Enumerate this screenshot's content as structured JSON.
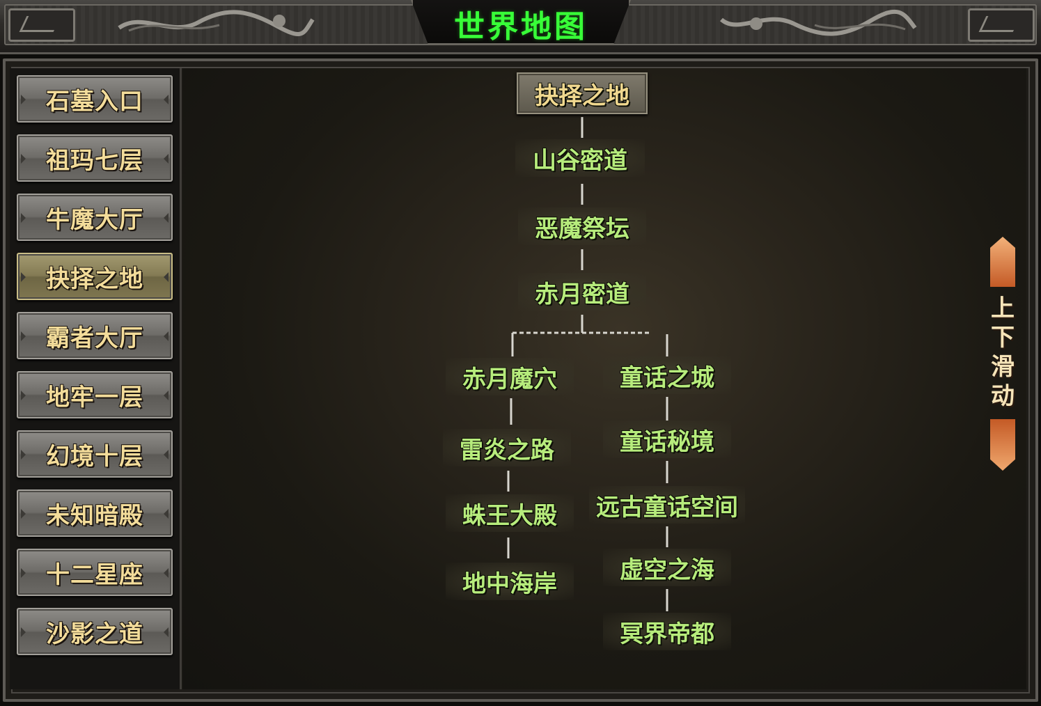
{
  "window": {
    "title": "世界地图"
  },
  "sidebar": {
    "items": [
      {
        "label": "石墓入口",
        "active": false
      },
      {
        "label": "祖玛七层",
        "active": false
      },
      {
        "label": "牛魔大厅",
        "active": false
      },
      {
        "label": "抉择之地",
        "active": true
      },
      {
        "label": "霸者大厅",
        "active": false
      },
      {
        "label": "地牢一层",
        "active": false
      },
      {
        "label": "幻境十层",
        "active": false
      },
      {
        "label": "未知暗殿",
        "active": false
      },
      {
        "label": "十二星座",
        "active": false
      },
      {
        "label": "沙影之道",
        "active": false
      }
    ]
  },
  "map": {
    "root": "抉择之地",
    "trunk": [
      "山谷密道",
      "恶魔祭坛",
      "赤月密道"
    ],
    "branch_left": [
      "赤月魔穴",
      "雷炎之路",
      "蛛王大殿",
      "地中海岸"
    ],
    "branch_right": [
      "童话之城",
      "童话秘境",
      "远古童话空间",
      "虚空之海",
      "冥界帝都"
    ]
  },
  "scroll_hint": {
    "label_chars": [
      "上",
      "下",
      "滑",
      "动"
    ]
  },
  "colors": {
    "title_green": "#38ff38",
    "node_text": "#b7ec7c",
    "sidebar_text": "#f3dc9a",
    "scroll_orange": "#c45a26"
  },
  "icons": {
    "title_ornament": "dragon-ornament",
    "scroll_up": "arrow-up-icon",
    "scroll_down": "arrow-down-icon"
  }
}
